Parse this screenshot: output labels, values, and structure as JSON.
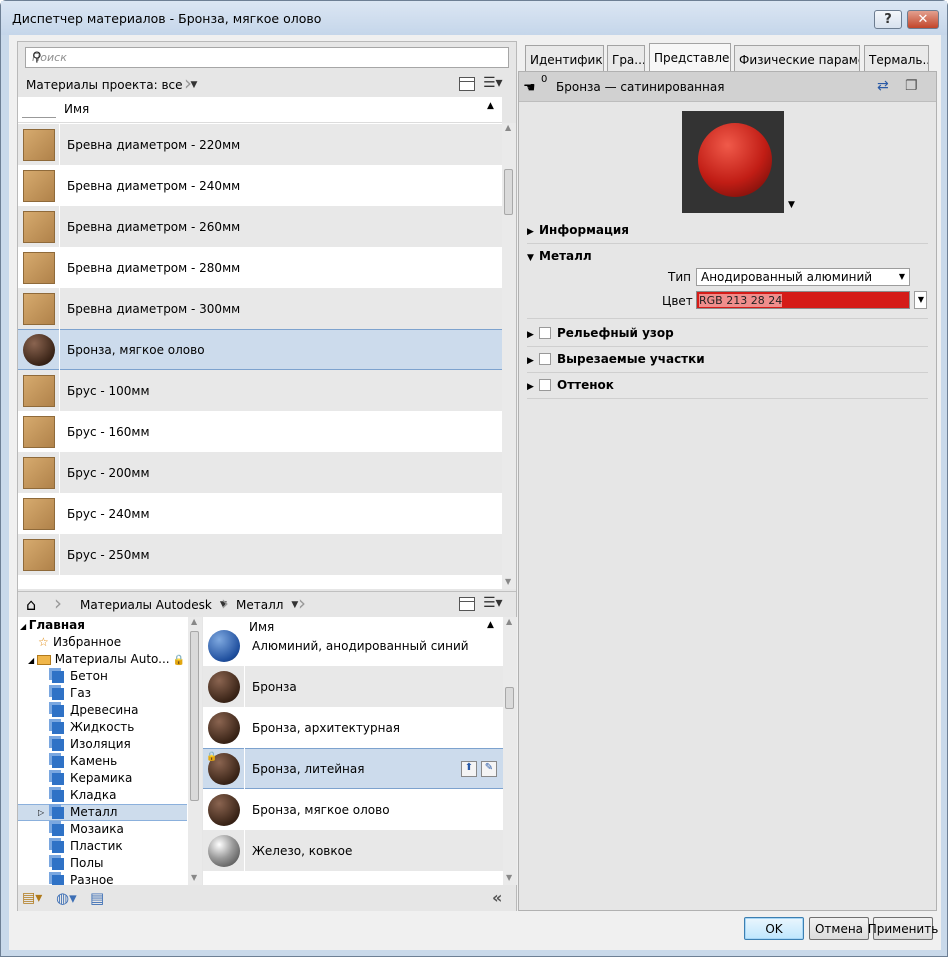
{
  "window": {
    "title": "Диспетчер материалов - Бронза, мягкое олово",
    "help_glyph": "?",
    "close_glyph": "✕"
  },
  "search": {
    "placeholder": "Поиск"
  },
  "project_filter": {
    "label": "Материалы проекта: все"
  },
  "project_table": {
    "column_name": "Имя",
    "rows": [
      {
        "label": "Бревна диаметром - 220мм",
        "thumb": "wood-box"
      },
      {
        "label": "Бревна диаметром - 240мм",
        "thumb": "wood-box"
      },
      {
        "label": "Бревна диаметром - 260мм",
        "thumb": "wood-box"
      },
      {
        "label": "Бревна диаметром - 280мм",
        "thumb": "wood-box"
      },
      {
        "label": "Бревна диаметром - 300мм",
        "thumb": "wood-box"
      },
      {
        "label": "Бронза, мягкое олово",
        "thumb": "bronze-sphere",
        "selected": true
      },
      {
        "label": "Брус - 100мм",
        "thumb": "wood-box"
      },
      {
        "label": "Брус - 160мм",
        "thumb": "wood-box"
      },
      {
        "label": "Брус - 200мм",
        "thumb": "wood-box"
      },
      {
        "label": "Брус - 240мм",
        "thumb": "wood-box"
      },
      {
        "label": "Брус - 250мм",
        "thumb": "wood-box"
      }
    ]
  },
  "library_nav": {
    "home_icon": "home-icon",
    "crumbs": [
      "Материалы Autodesk",
      "Металл"
    ]
  },
  "library_tree": [
    {
      "label": "Главная",
      "level": 0,
      "bold": true,
      "expander": "▲"
    },
    {
      "label": "Избранное",
      "level": 1,
      "icon": "star-icon"
    },
    {
      "label": "Материалы Auto...",
      "level": 1,
      "icon": "folder-icon",
      "expander": "◢"
    },
    {
      "label": "Бетон",
      "level": 2
    },
    {
      "label": "Газ",
      "level": 2
    },
    {
      "label": "Древесина",
      "level": 2
    },
    {
      "label": "Жидкость",
      "level": 2
    },
    {
      "label": "Изоляция",
      "level": 2
    },
    {
      "label": "Камень",
      "level": 2
    },
    {
      "label": "Керамика",
      "level": 2
    },
    {
      "label": "Кладка",
      "level": 2
    },
    {
      "label": "Металл",
      "level": 2,
      "selected": true
    },
    {
      "label": "Мозаика",
      "level": 2
    },
    {
      "label": "Пластик",
      "level": 2
    },
    {
      "label": "Полы",
      "level": 2
    },
    {
      "label": "Разное",
      "level": 2
    }
  ],
  "library_table": {
    "column_name": "Имя",
    "rows": [
      {
        "label": "Алюминий, анодированный синий",
        "thumb": "blue-sphere"
      },
      {
        "label": "Бронза",
        "thumb": "bronze-sphere"
      },
      {
        "label": "Бронза, архитектурная",
        "thumb": "bronze-sphere"
      },
      {
        "label": "Бронза, литейная",
        "thumb": "bronze-sphere",
        "selected": true
      },
      {
        "label": "Бронза, мягкое олово",
        "thumb": "bronze-sphere"
      },
      {
        "label": "Железо, ковкое",
        "thumb": "steel-sphere"
      }
    ]
  },
  "tabs": [
    "Идентифик...",
    "Гра...",
    "Представле...",
    "Физические параме...",
    "Термаль..."
  ],
  "active_tab": 2,
  "asset": {
    "count": "0",
    "name": "Бронза — сатинированная"
  },
  "sections": {
    "info": "Информация",
    "metal": "Металл",
    "relief": "Рельефный узор",
    "cutouts": "Вырезаемые участки",
    "tint": "Оттенок"
  },
  "metal": {
    "type_label": "Тип",
    "type_value": "Анодированный алюминий",
    "color_label": "Цвет",
    "color_value": "RGB 213 28 24",
    "color_hex": "#d51c18"
  },
  "buttons": {
    "ok": "OK",
    "cancel": "Отмена",
    "apply": "Применить"
  }
}
